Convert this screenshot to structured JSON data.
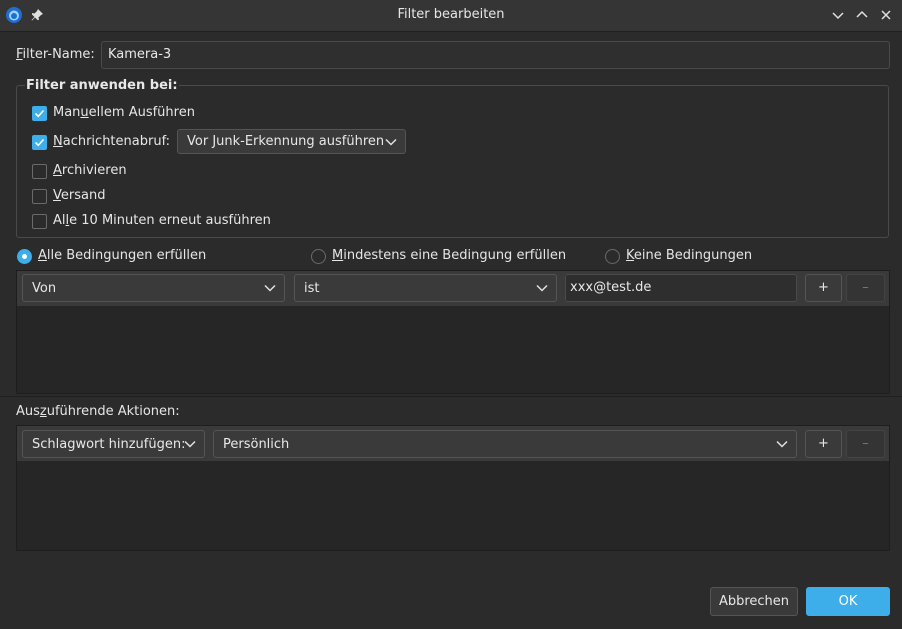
{
  "window": {
    "title": "Filter bearbeiten",
    "icons": [
      "app-icon",
      "pin-icon",
      "minimize-icon",
      "maximize-icon",
      "close-icon"
    ]
  },
  "filter_name": {
    "label_prefix": "F",
    "label_rest": "ilter-Name:",
    "value": "Kamera-3"
  },
  "apply_group": {
    "title": "Filter anwenden bei:",
    "manual": {
      "pre": "Man",
      "ul": "u",
      "post": "ellem Ausführen",
      "checked": true
    },
    "fetch": {
      "pre": "",
      "ul": "N",
      "post": "achrichtenabruf:",
      "checked": true,
      "option": "Vor Junk-Erkennung ausführen"
    },
    "archive": {
      "pre": "",
      "ul": "A",
      "post": "rchivieren",
      "checked": false
    },
    "send": {
      "pre": "",
      "ul": "V",
      "post": "ersand",
      "checked": false
    },
    "periodic": {
      "pre": "Al",
      "ul": "l",
      "post": "e 10 Minuten erneut ausführen",
      "checked": false
    }
  },
  "match": {
    "all": {
      "pre": "",
      "ul": "A",
      "post": "lle Bedingungen erfüllen",
      "selected": true
    },
    "any": {
      "pre": "",
      "ul": "M",
      "post": "indestens eine Bedingung erfüllen",
      "selected": false
    },
    "none": {
      "pre": "",
      "ul": "K",
      "post": "eine Bedingungen",
      "selected": false
    }
  },
  "conditions": [
    {
      "field": "Von",
      "operator": "ist",
      "value": "xxx@test.de",
      "add": "+",
      "remove": "–"
    }
  ],
  "actions_label": {
    "pre": "Aus",
    "ul": "z",
    "post": "uführende Aktionen:"
  },
  "actions": [
    {
      "action": "Schlagwort hinzufügen:",
      "value": "Persönlich",
      "add": "+",
      "remove": "–"
    }
  ],
  "footer": {
    "cancel": "Abbrechen",
    "ok": "OK"
  },
  "colors": {
    "accent": "#3daee9",
    "background": "#2b2b2b",
    "field": "#3a3a3a",
    "list": "#262626"
  }
}
